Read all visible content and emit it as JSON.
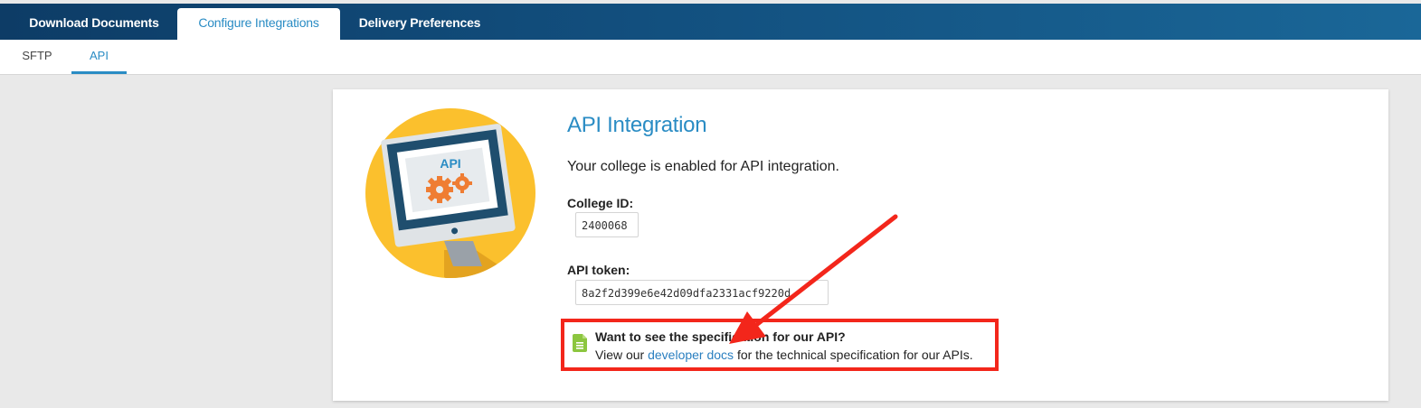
{
  "top_tabs": [
    {
      "label": "Download Documents",
      "active": false
    },
    {
      "label": "Configure Integrations",
      "active": true
    },
    {
      "label": "Delivery Preferences",
      "active": false
    }
  ],
  "sub_tabs": [
    {
      "label": "SFTP",
      "active": false
    },
    {
      "label": "API",
      "active": true
    }
  ],
  "card": {
    "illustration_text": "API",
    "title": "API Integration",
    "status": "Your college is enabled for API integration.",
    "college_id_label": "College ID:",
    "college_id_value": "2400068",
    "api_token_label": "API token:",
    "api_token_value": "8a2f2d399e6e42d09dfa2331acf9220d",
    "callout": {
      "title": "Want to see the specification for our API?",
      "body_prefix": "View our ",
      "link_text": "developer docs",
      "body_suffix": " for the technical specification for our APIs."
    }
  },
  "colors": {
    "accent": "#2a8cc4",
    "header_dark": "#0d3c66",
    "callout_border": "#f3261b",
    "annotation_arrow": "#f3261b",
    "illustration_bg": "#fbc02d",
    "doc_icon": "#8cc63f"
  },
  "icons": {
    "doc_icon": "document-icon",
    "gear_icon": "gear-icon"
  }
}
